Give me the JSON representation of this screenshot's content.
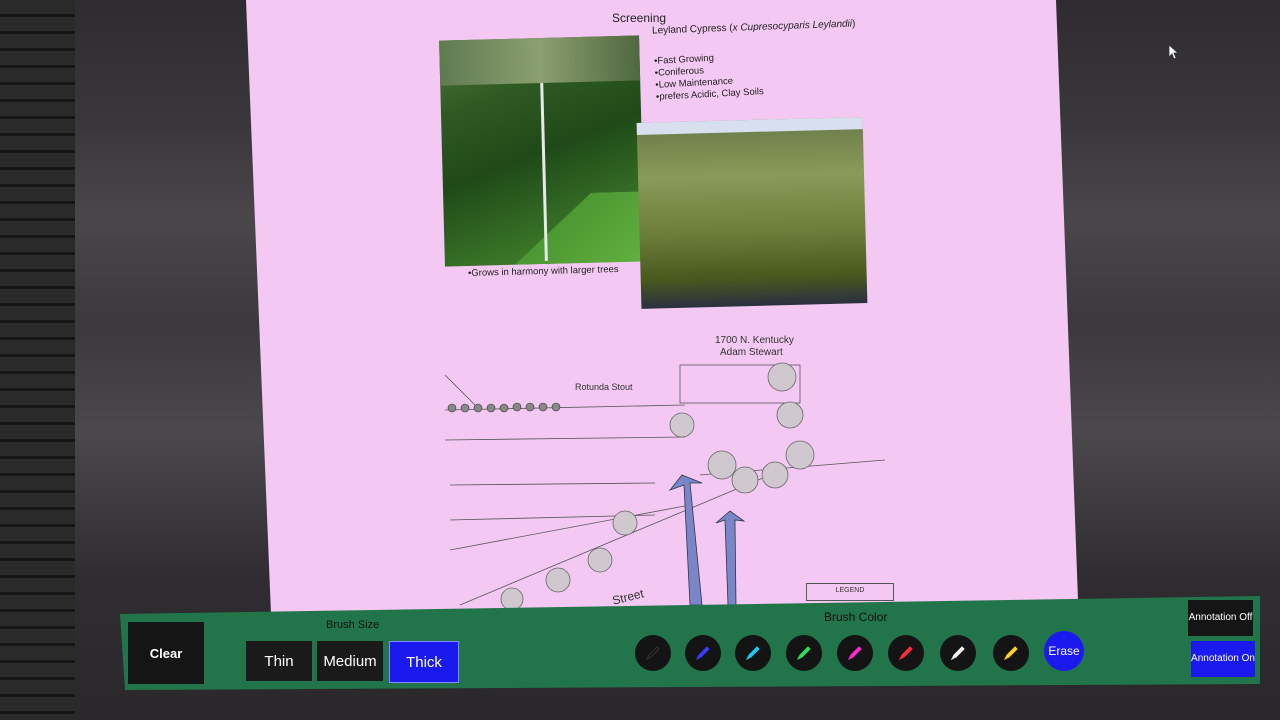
{
  "slide": {
    "title": "Screening",
    "plant_name": "Leyland Cypress (",
    "plant_latin": "x Cupresocyparis Leylandii",
    "plant_close": ")",
    "bullets": [
      "Fast Growing",
      "Coniferous",
      "Low Maintenance",
      "prefers Acidic, Clay Soils"
    ],
    "caption": "Grows in harmony with larger trees",
    "plan": {
      "street_label": "Street",
      "legend_label": "LEGEND",
      "note_1": "1700 N. Kentucky",
      "note_2": "Adam Stewart",
      "note_3": "Rotunda Stout"
    }
  },
  "toolbar": {
    "clear_label": "Clear",
    "brush_size_label": "Brush Size",
    "sizes": [
      "Thin",
      "Medium",
      "Thick"
    ],
    "selected_size": "Thick",
    "brush_color_label": "Brush Color",
    "colors": [
      {
        "name": "black",
        "hex": "#111111"
      },
      {
        "name": "blue",
        "hex": "#3b3bff"
      },
      {
        "name": "cyan",
        "hex": "#22c8f0"
      },
      {
        "name": "green",
        "hex": "#2ee05a"
      },
      {
        "name": "magenta",
        "hex": "#ff2ad4"
      },
      {
        "name": "red",
        "hex": "#ff2a3a"
      },
      {
        "name": "white",
        "hex": "#f2f2f2"
      },
      {
        "name": "yellow",
        "hex": "#ffd21a"
      }
    ],
    "erase_label": "Erase",
    "annotation_off_label": "Annotation Off",
    "annotation_on_label": "Annotation On"
  }
}
